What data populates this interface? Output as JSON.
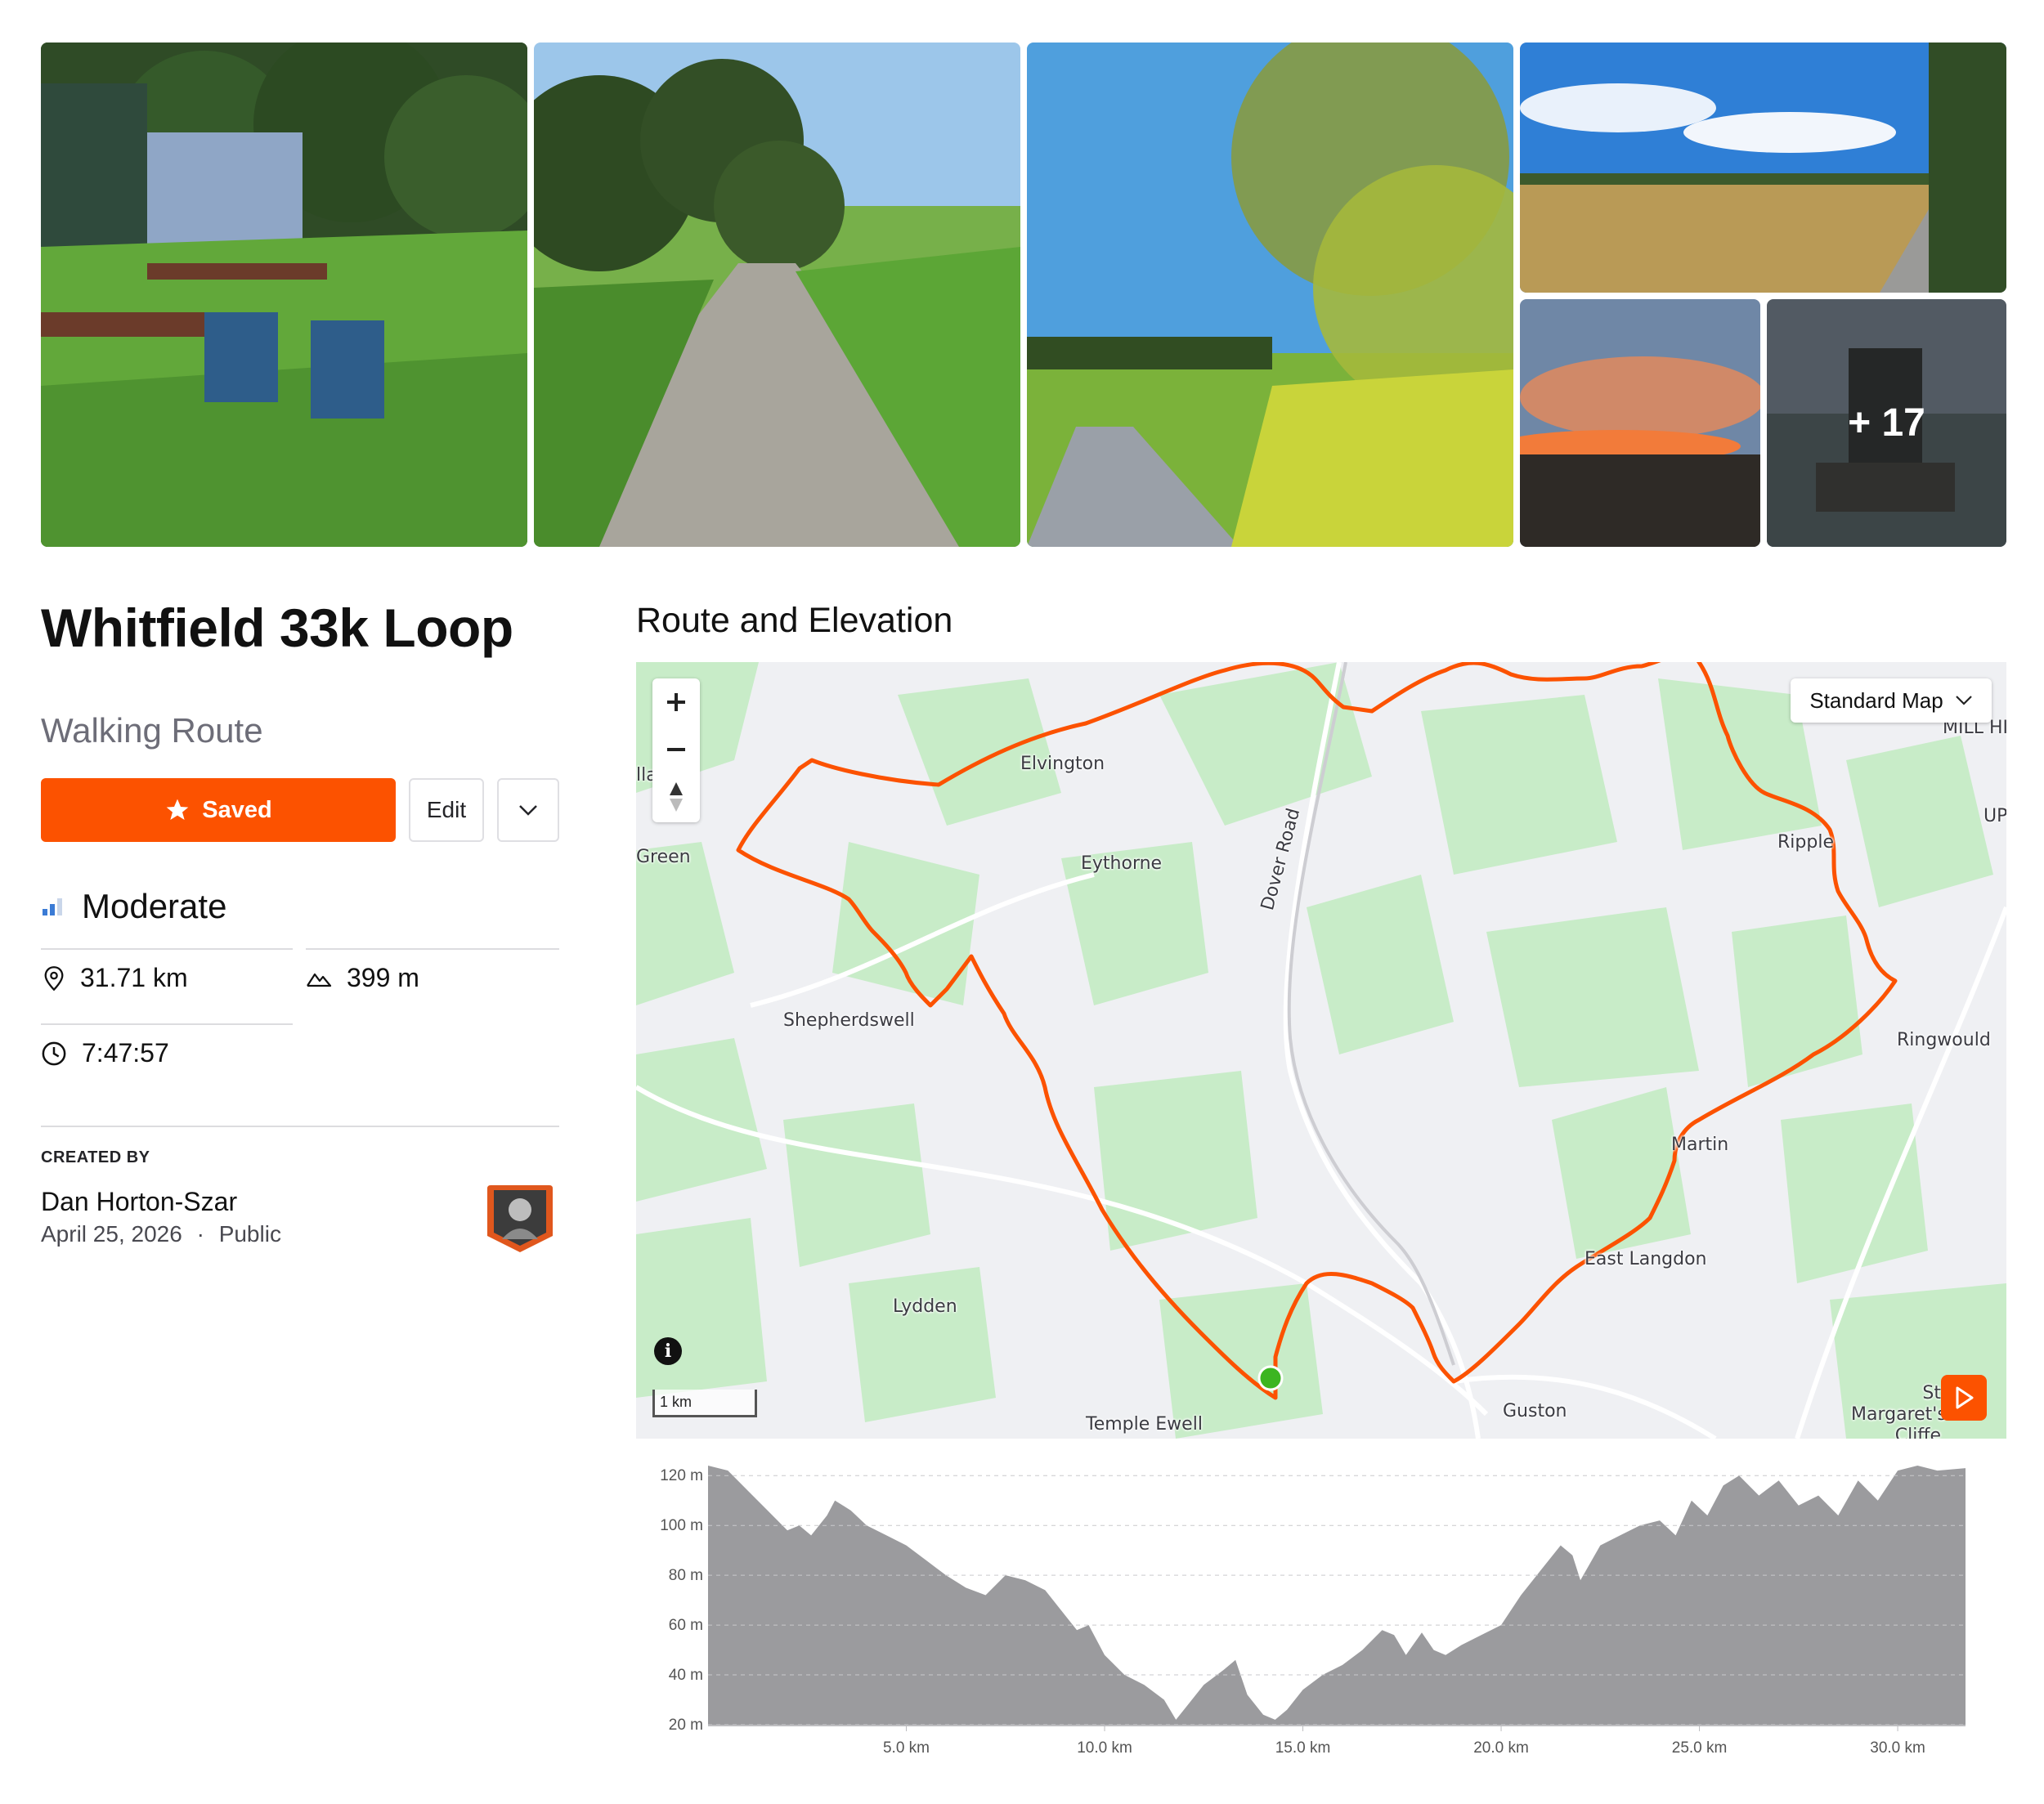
{
  "gallery": {
    "more_count": "+ 17"
  },
  "route": {
    "title": "Whitfield 33k Loop",
    "type": "Walking Route",
    "saved_label": "Saved",
    "edit_label": "Edit",
    "difficulty": "Moderate",
    "distance": "31.71 km",
    "elevation_gain": "399 m",
    "duration": "7:47:57",
    "created_by_label": "CREATED BY",
    "author": "Dan Horton-Szar",
    "date": "April 25, 2026",
    "visibility": "Public",
    "meta_separator": "·"
  },
  "map_section": {
    "title": "Route and Elevation",
    "map_style": "Standard Map",
    "scale": "1 km",
    "info_icon": "i",
    "places": [
      "Elvington",
      "Eythorne",
      "Shepherdswell",
      "Green",
      "Lydden",
      "Temple Ewell",
      "Dover Road",
      "Ripple",
      "Ringwould",
      "Martin",
      "East Langdon",
      "Guston",
      "St Margaret's Cliffe",
      "MILL HI",
      "UP",
      "lla..."
    ],
    "colors": {
      "route": "#fc5200",
      "start_marker": "#3cb521",
      "water_green": "#c6ecc6",
      "land": "#eff0f3"
    }
  },
  "chart_data": {
    "type": "area",
    "title": "",
    "xlabel": "",
    "ylabel": "",
    "xlim": [
      0,
      31.71
    ],
    "ylim": [
      20,
      125
    ],
    "y_ticks": [
      "20 m",
      "40 m",
      "60 m",
      "80 m",
      "100 m",
      "120 m"
    ],
    "x_ticks": [
      "5.0 km",
      "10.0 km",
      "15.0 km",
      "20.0 km",
      "25.0 km",
      "30.0 km"
    ],
    "x": [
      0,
      0.5,
      1.0,
      1.5,
      2.0,
      2.3,
      2.6,
      3.0,
      3.2,
      3.4,
      3.6,
      3.8,
      4.0,
      4.5,
      5.0,
      5.5,
      6.0,
      6.5,
      7.0,
      7.5,
      8.0,
      8.5,
      9.0,
      9.3,
      9.6,
      10.0,
      10.5,
      11.0,
      11.5,
      11.8,
      12.1,
      12.5,
      13.0,
      13.3,
      13.6,
      14.0,
      14.3,
      14.6,
      15.0,
      15.5,
      16.0,
      16.5,
      17.0,
      17.3,
      17.6,
      18.0,
      18.3,
      18.6,
      19.0,
      19.5,
      20.0,
      20.5,
      21.0,
      21.5,
      21.8,
      22.0,
      22.5,
      23.0,
      23.5,
      24.0,
      24.4,
      24.8,
      25.2,
      25.6,
      26.0,
      26.5,
      27.0,
      27.5,
      28.0,
      28.5,
      29.0,
      29.5,
      30.0,
      30.5,
      31.0,
      31.71
    ],
    "values": [
      124,
      122,
      114,
      106,
      98,
      100,
      96,
      104,
      110,
      108,
      106,
      103,
      100,
      96,
      92,
      86,
      80,
      75,
      72,
      80,
      78,
      74,
      64,
      58,
      60,
      48,
      40,
      36,
      30,
      22,
      28,
      36,
      42,
      46,
      32,
      24,
      22,
      26,
      34,
      40,
      44,
      50,
      58,
      56,
      48,
      57,
      50,
      48,
      52,
      56,
      60,
      72,
      82,
      92,
      88,
      78,
      92,
      96,
      100,
      102,
      96,
      110,
      104,
      116,
      120,
      112,
      118,
      108,
      112,
      104,
      118,
      110,
      122,
      124,
      122,
      123
    ]
  }
}
